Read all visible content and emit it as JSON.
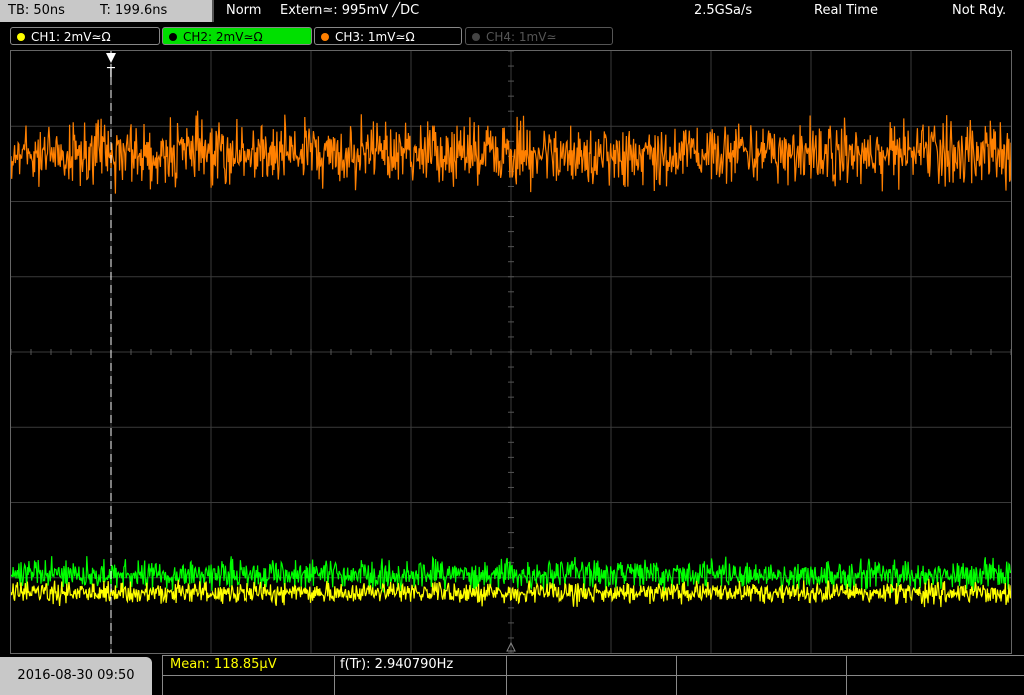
{
  "topbar": {
    "tb": "TB: 50ns",
    "t": "T: 199.6ns",
    "mode": "Norm",
    "trigger": "Extern≃: 995mV ╱DC",
    "sample_rate": "2.5GSa/s",
    "acq": "Real Time",
    "state": "Not Rdy."
  },
  "channels": [
    {
      "label": "CH1: 2mV≃Ω",
      "color": "#ffff00",
      "active": false
    },
    {
      "label": "CH2: 2mV≃Ω",
      "color": "#00ff00",
      "active": true
    },
    {
      "label": "CH3: 1mV≃Ω",
      "color": "#ff8000",
      "active": false
    },
    {
      "label": "CH4: 1mV≃",
      "color": "#666666",
      "active": false
    }
  ],
  "trigger_marker": "T",
  "bottom": {
    "date": "2016-08-30 09:50",
    "mean": "Mean: 118.85µV",
    "freq": "f(Tr): 2.940790Hz"
  },
  "colors": {
    "ch1": "#ffff00",
    "ch2": "#00ff00",
    "ch3": "#ff8000",
    "grid": "#3a3a3a"
  },
  "waveforms": {
    "ch1_level": 0.9,
    "ch2_level": 0.87,
    "ch3_level": 0.17,
    "trigger_pos": 0.1
  }
}
